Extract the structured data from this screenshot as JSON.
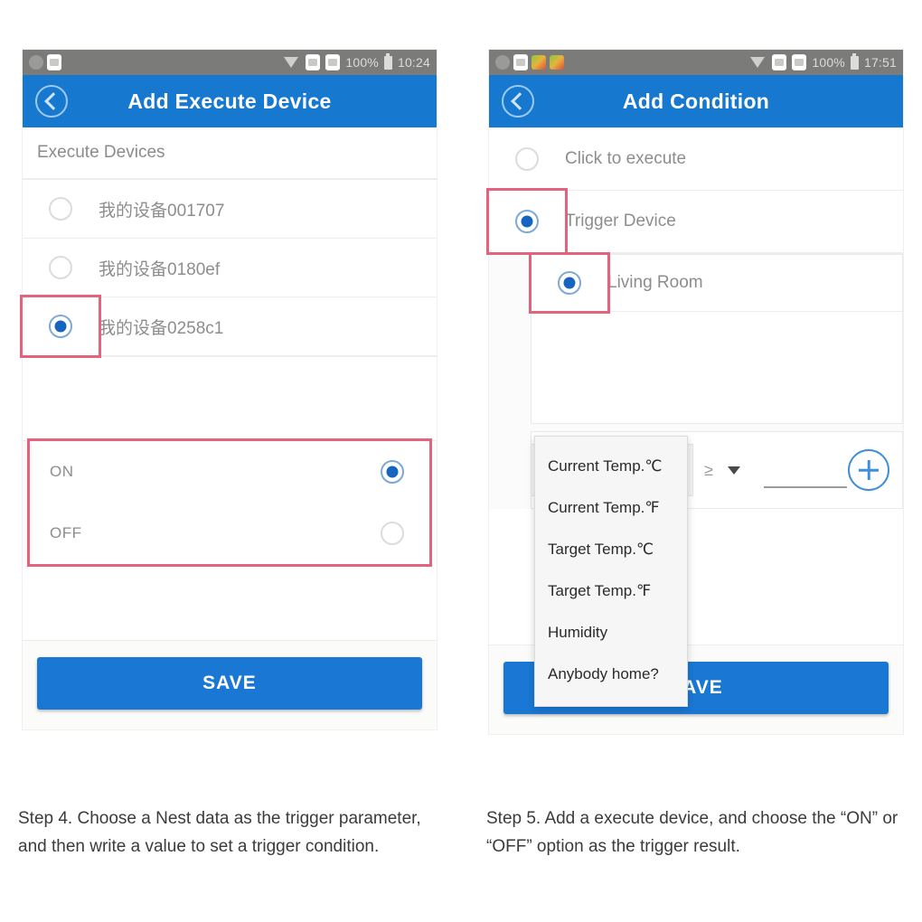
{
  "theme": {
    "header_blue": "#1678cf",
    "save_blue": "#1a78d4",
    "highlight_red": "#e3637c",
    "radio_blue": "#1565c0",
    "statusbar_grey": "#7b7b79"
  },
  "left_panel": {
    "statusbar": {
      "left_icons": [
        "face-icon",
        "screenshot-icon"
      ],
      "wifi_icon": "wifi-icon",
      "right_icons": [
        "sd-card-icon",
        "sd-card-icon"
      ],
      "battery_percent": "100%",
      "battery_icon": "battery-icon",
      "time": "10:24"
    },
    "appbar": {
      "back_icon": "back-chevron-icon",
      "title": "Add Execute Device"
    },
    "section_label": "Execute Devices",
    "devices": [
      {
        "label": "我的设备001707",
        "selected": false,
        "highlighted": false
      },
      {
        "label": "我的设备0180ef",
        "selected": false,
        "highlighted": false
      },
      {
        "label": "我的设备0258c1",
        "selected": true,
        "highlighted": true
      }
    ],
    "state_options": [
      {
        "label": "ON",
        "selected": true
      },
      {
        "label": "OFF",
        "selected": false
      }
    ],
    "save_label": "SAVE"
  },
  "right_panel": {
    "statusbar": {
      "left_icons": [
        "face-icon",
        "screenshot-icon",
        "app-icon",
        "app-icon"
      ],
      "wifi_icon": "wifi-icon",
      "right_icons": [
        "sd-card-icon",
        "sd-card-icon"
      ],
      "battery_percent": "100%",
      "battery_icon": "battery-icon",
      "time": "17:51"
    },
    "appbar": {
      "back_icon": "back-chevron-icon",
      "title": "Add Condition"
    },
    "condition_types": [
      {
        "label": "Click to execute",
        "selected": false,
        "highlighted": false
      },
      {
        "label": "Trigger Device",
        "selected": true,
        "highlighted": true
      }
    ],
    "trigger_devices": [
      {
        "label": "Living Room",
        "selected": true,
        "highlighted": true
      }
    ],
    "parameter_row": {
      "parameter_value": "",
      "operator": "≥",
      "operator_caret_icon": "chevron-down-icon",
      "value": "",
      "add_icon": "plus-icon"
    },
    "dropdown": {
      "items": [
        "Current Temp.℃",
        "Current Temp.℉",
        "Target Temp.℃",
        "Target Temp.℉",
        "Humidity",
        "Anybody home?"
      ]
    },
    "save_label": "SAVE"
  },
  "captions": {
    "left": "Step 4. Choose a Nest data as the trigger parameter, and then write a value to set a trigger condition.",
    "right": "Step 5. Add a execute device, and choose the “ON” or “OFF” option as the trigger result."
  }
}
